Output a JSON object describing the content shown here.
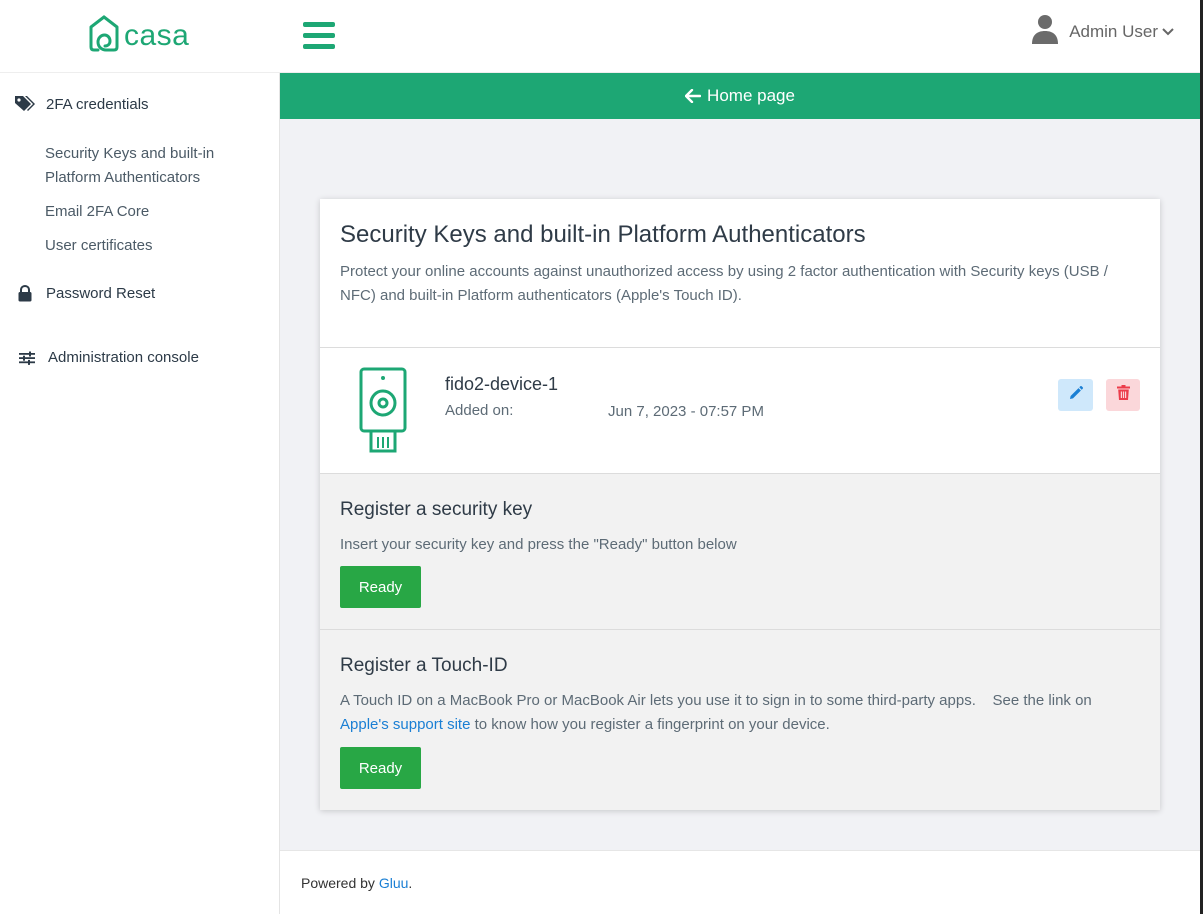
{
  "header": {
    "brand": "casa",
    "user_name": "Admin User",
    "brand_color": "#1da774"
  },
  "sidebar": {
    "groups": [
      {
        "label": "2FA credentials",
        "icon": "tags-icon",
        "items": [
          {
            "label_line1": "Security Keys and built-in",
            "label_line2": "Platform Authenticators"
          },
          {
            "label": "Email 2FA Core"
          },
          {
            "label": "User certificates"
          }
        ]
      },
      {
        "label": "Password Reset",
        "icon": "lock-icon"
      },
      {
        "label": "Administration console",
        "icon": "sliders-icon"
      }
    ]
  },
  "main": {
    "home_link": "Home page",
    "card": {
      "title": "Security Keys and built-in Platform Authenticators",
      "description": "Protect your online accounts against unauthorized access by using 2 factor authentication with Security keys (USB / NFC) and built-in Platform authenticators (Apple's Touch ID).",
      "device": {
        "name": "fido2-device-1",
        "added_label": "Added on:",
        "added_value": "Jun 7, 2023 - 07:57 PM"
      },
      "register_key": {
        "title": "Register a security key",
        "text": "Insert your security key and press the \"Ready\" button below",
        "button": "Ready"
      },
      "register_touch": {
        "title": "Register a Touch-ID",
        "text_before": "A Touch ID on a MacBook Pro or MacBook Air lets you use it to sign in to some third-party apps.    See the link on ",
        "link": "Apple's support site",
        "text_after": " to know how you register a fingerprint on your device.",
        "button": "Ready"
      }
    }
  },
  "footer": {
    "text": "Powered by ",
    "link": "Gluu",
    "end": "."
  }
}
